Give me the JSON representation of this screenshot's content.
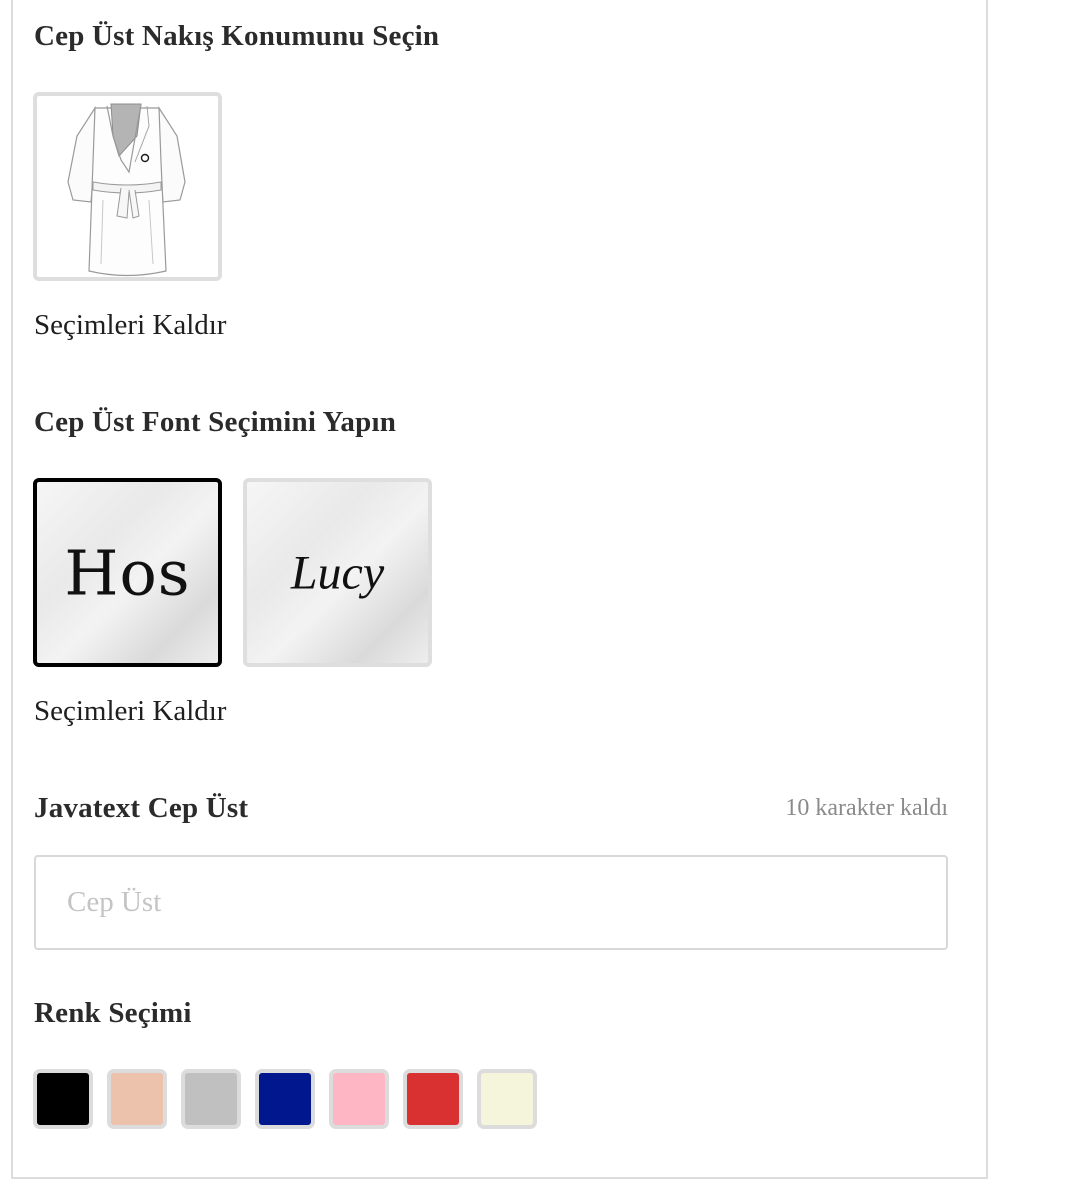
{
  "embroidery_position": {
    "title": "Cep Üst Nakış Konumunu Seçin",
    "remove_label": "Seçimleri Kaldır",
    "options": [
      {
        "icon": "bathrobe-left-chest-icon"
      }
    ]
  },
  "font_selection": {
    "title": "Cep Üst Font Seçimini Yapın",
    "remove_label": "Seçimleri Kaldır",
    "options": [
      {
        "sample": "Hos",
        "selected": true
      },
      {
        "sample": "Lucy",
        "selected": false
      }
    ]
  },
  "text_field": {
    "label": "Javatext Cep Üst",
    "counter": "10 karakter kaldı",
    "placeholder": "Cep Üst",
    "value": ""
  },
  "color_selection": {
    "title": "Renk Seçimi",
    "swatches": [
      "#000000",
      "#ecc2ad",
      "#c0c0c0",
      "#00178e",
      "#ffb6c4",
      "#d93131",
      "#f5f5dc"
    ]
  }
}
